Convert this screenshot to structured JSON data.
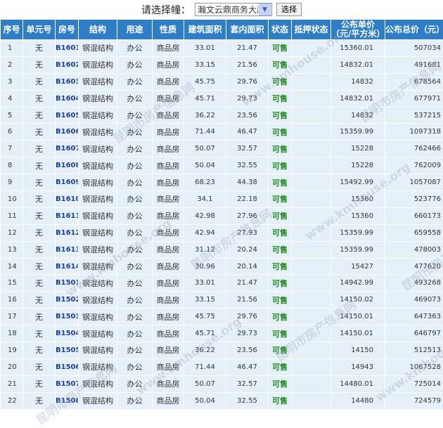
{
  "selector": {
    "prompt": "请选择幢：",
    "selected": "瀚文云鼎商务大厦",
    "button_label": "选择"
  },
  "columns": [
    "序号",
    "单元号",
    "房号",
    "结构",
    "用途",
    "性质",
    "建筑面积",
    "套内面积",
    "状态",
    "抵押状态",
    "公布单价\n（元/平方米）",
    "公布总价（元）"
  ],
  "rows": [
    {
      "no": "1",
      "unit": "无",
      "room": "B1601",
      "struct": "钢混结构",
      "use": "办公",
      "nature": "商品房",
      "area": "33.01",
      "inner": "21.47",
      "status": "可售",
      "mortgage": "",
      "price": "15360.01",
      "total": "507034"
    },
    {
      "no": "2",
      "unit": "无",
      "room": "B1602",
      "struct": "钢混结构",
      "use": "办公",
      "nature": "商品房",
      "area": "33.15",
      "inner": "21.56",
      "status": "可售",
      "mortgage": "",
      "price": "14832.01",
      "total": "491681"
    },
    {
      "no": "3",
      "unit": "无",
      "room": "B1603",
      "struct": "钢混结构",
      "use": "办公",
      "nature": "商品房",
      "area": "45.75",
      "inner": "29.76",
      "status": "可售",
      "mortgage": "",
      "price": "14832",
      "total": "678564"
    },
    {
      "no": "4",
      "unit": "无",
      "room": "B1604",
      "struct": "钢混结构",
      "use": "办公",
      "nature": "商品房",
      "area": "45.71",
      "inner": "29.73",
      "status": "可售",
      "mortgage": "",
      "price": "14832.01",
      "total": "677971"
    },
    {
      "no": "5",
      "unit": "无",
      "room": "B1605",
      "struct": "钢混结构",
      "use": "办公",
      "nature": "商品房",
      "area": "36.22",
      "inner": "23.56",
      "status": "可售",
      "mortgage": "",
      "price": "14832",
      "total": "537215"
    },
    {
      "no": "6",
      "unit": "无",
      "room": "B1606",
      "struct": "钢混结构",
      "use": "办公",
      "nature": "商品房",
      "area": "71.44",
      "inner": "46.47",
      "status": "可售",
      "mortgage": "",
      "price": "15359.99",
      "total": "1097318"
    },
    {
      "no": "7",
      "unit": "无",
      "room": "B1607",
      "struct": "钢混结构",
      "use": "办公",
      "nature": "商品房",
      "area": "50.07",
      "inner": "32.57",
      "status": "可售",
      "mortgage": "",
      "price": "15228",
      "total": "762466"
    },
    {
      "no": "8",
      "unit": "无",
      "room": "B1608",
      "struct": "钢混结构",
      "use": "办公",
      "nature": "商品房",
      "area": "50.04",
      "inner": "32.55",
      "status": "可售",
      "mortgage": "",
      "price": "15228",
      "total": "762009"
    },
    {
      "no": "9",
      "unit": "无",
      "room": "B1609",
      "struct": "钢混结构",
      "use": "办公",
      "nature": "商品房",
      "area": "68.23",
      "inner": "44.38",
      "status": "可售",
      "mortgage": "",
      "price": "15492.99",
      "total": "1057087"
    },
    {
      "no": "10",
      "unit": "无",
      "room": "B1610",
      "struct": "钢混结构",
      "use": "办公",
      "nature": "商品房",
      "area": "34.1",
      "inner": "22.18",
      "status": "可售",
      "mortgage": "",
      "price": "15360",
      "total": "523776"
    },
    {
      "no": "11",
      "unit": "无",
      "room": "B1611",
      "struct": "钢混结构",
      "use": "办公",
      "nature": "商品房",
      "area": "42.98",
      "inner": "27.96",
      "status": "可售",
      "mortgage": "",
      "price": "15360",
      "total": "660173"
    },
    {
      "no": "12",
      "unit": "无",
      "room": "B1612",
      "struct": "钢混结构",
      "use": "办公",
      "nature": "商品房",
      "area": "42.94",
      "inner": "27.93",
      "status": "可售",
      "mortgage": "",
      "price": "15359.99",
      "total": "659558"
    },
    {
      "no": "13",
      "unit": "无",
      "room": "B1613",
      "struct": "钢混结构",
      "use": "办公",
      "nature": "商品房",
      "area": "31.12",
      "inner": "20.24",
      "status": "可售",
      "mortgage": "",
      "price": "15359.99",
      "total": "478003"
    },
    {
      "no": "14",
      "unit": "无",
      "room": "B1614",
      "struct": "钢混结构",
      "use": "办公",
      "nature": "商品房",
      "area": "30.96",
      "inner": "20.14",
      "status": "可售",
      "mortgage": "",
      "price": "15427",
      "total": "477620"
    },
    {
      "no": "15",
      "unit": "无",
      "room": "B1501",
      "struct": "钢混结构",
      "use": "办公",
      "nature": "商品房",
      "area": "33.01",
      "inner": "21.47",
      "status": "可售",
      "mortgage": "",
      "price": "14942.99",
      "total": "493268"
    },
    {
      "no": "16",
      "unit": "无",
      "room": "B1502",
      "struct": "钢混结构",
      "use": "办公",
      "nature": "商品房",
      "area": "33.15",
      "inner": "21.56",
      "status": "可售",
      "mortgage": "",
      "price": "14150.02",
      "total": "469073"
    },
    {
      "no": "17",
      "unit": "无",
      "room": "B1503",
      "struct": "钢混结构",
      "use": "办公",
      "nature": "商品房",
      "area": "45.75",
      "inner": "29.76",
      "status": "可售",
      "mortgage": "",
      "price": "14150.01",
      "total": "647363"
    },
    {
      "no": "18",
      "unit": "无",
      "room": "B1504",
      "struct": "钢混结构",
      "use": "办公",
      "nature": "商品房",
      "area": "45.71",
      "inner": "29.73",
      "status": "可售",
      "mortgage": "",
      "price": "14150.01",
      "total": "646797"
    },
    {
      "no": "19",
      "unit": "无",
      "room": "B1505",
      "struct": "钢混结构",
      "use": "办公",
      "nature": "商品房",
      "area": "36.22",
      "inner": "23.56",
      "status": "可售",
      "mortgage": "",
      "price": "14150",
      "total": "512513"
    },
    {
      "no": "20",
      "unit": "无",
      "room": "B1506",
      "struct": "钢混结构",
      "use": "办公",
      "nature": "商品房",
      "area": "71.44",
      "inner": "46.47",
      "status": "可售",
      "mortgage": "",
      "price": "14943",
      "total": "1067528"
    },
    {
      "no": "21",
      "unit": "无",
      "room": "B1507",
      "struct": "钢混结构",
      "use": "办公",
      "nature": "商品房",
      "area": "50.07",
      "inner": "32.57",
      "status": "可售",
      "mortgage": "",
      "price": "14480.01",
      "total": "725014"
    },
    {
      "no": "22",
      "unit": "无",
      "room": "B1508",
      "struct": "钢混结构",
      "use": "办公",
      "nature": "商品房",
      "area": "50.04",
      "inner": "32.55",
      "status": "可售",
      "mortgage": "",
      "price": "14480",
      "total": "724579"
    }
  ],
  "watermarks": [
    "昆明市房产信息网",
    "www.kmhouse.org"
  ],
  "colors": {
    "header_bg": "#2d7ec7",
    "row_bg": "#e6f0f8",
    "status_green": "#1a8a1a",
    "room_blue": "#1a3f9c"
  }
}
